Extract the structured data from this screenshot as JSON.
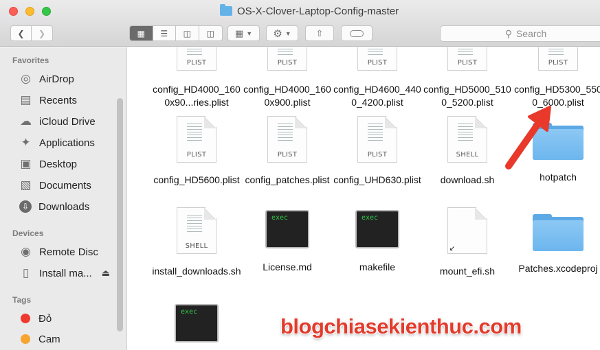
{
  "window": {
    "title": "OS-X-Clover-Laptop-Config-master"
  },
  "toolbar": {
    "back_icon": "chevron-left-icon",
    "forward_icon": "chevron-right-icon",
    "view_modes": [
      "icon-view",
      "list-view",
      "column-view",
      "cover-flow-view"
    ],
    "arrange_icon": "grid-arrange-icon",
    "action_icon": "gear-icon",
    "share_icon": "share-icon",
    "tag_icon": "tag-icon",
    "search_placeholder": "Search"
  },
  "sidebar": {
    "favorites_header": "Favorites",
    "favorites": [
      {
        "label": "AirDrop",
        "icon": "airdrop-icon"
      },
      {
        "label": "Recents",
        "icon": "recents-icon"
      },
      {
        "label": "iCloud Drive",
        "icon": "cloud-icon"
      },
      {
        "label": "Applications",
        "icon": "applications-icon"
      },
      {
        "label": "Desktop",
        "icon": "desktop-icon"
      },
      {
        "label": "Documents",
        "icon": "documents-icon"
      },
      {
        "label": "Downloads",
        "icon": "downloads-icon"
      }
    ],
    "devices_header": "Devices",
    "devices": [
      {
        "label": "Remote Disc",
        "icon": "disc-icon"
      },
      {
        "label": "Install ma...",
        "icon": "drive-icon",
        "eject": "⏏"
      }
    ],
    "tags_header": "Tags",
    "tags": [
      {
        "label": "Đỏ",
        "color": "#f03a2f"
      },
      {
        "label": "Cam",
        "color": "#f7a431"
      }
    ]
  },
  "files": {
    "row1": [
      {
        "name": "config_HD4000_1600x90...ries.plist",
        "type": "PLIST"
      },
      {
        "name": "config_HD4000_1600x900.plist",
        "type": "PLIST"
      },
      {
        "name": "config_HD4600_4400_4200.plist",
        "type": "PLIST"
      },
      {
        "name": "config_HD5000_5100_5200.plist",
        "type": "PLIST"
      },
      {
        "name": "config_HD5300_5500_6000.plist",
        "type": "PLIST"
      }
    ],
    "row2": [
      {
        "name": "config_HD5600.plist",
        "type": "PLIST"
      },
      {
        "name": "config_patches.plist",
        "type": "PLIST"
      },
      {
        "name": "config_UHD630.plist",
        "type": "PLIST"
      },
      {
        "name": "download.sh",
        "type": "SHELL"
      },
      {
        "name": "hotpatch",
        "type": "folder"
      }
    ],
    "row3": [
      {
        "name": "install_downloads.sh",
        "type": "SHELL"
      },
      {
        "name": "License.md",
        "type": "exec"
      },
      {
        "name": "makefile",
        "type": "exec"
      },
      {
        "name": "mount_efi.sh",
        "type": "alias"
      },
      {
        "name": "Patches.xcodeproj",
        "type": "folder"
      }
    ],
    "row4": [
      {
        "name": "",
        "type": "exec"
      }
    ]
  },
  "watermark": "blogchiasekienthuc.com",
  "colors": {
    "accent_arrow": "#e8392b",
    "folder": "#6cb6ee",
    "exec_text": "#30c84a"
  }
}
